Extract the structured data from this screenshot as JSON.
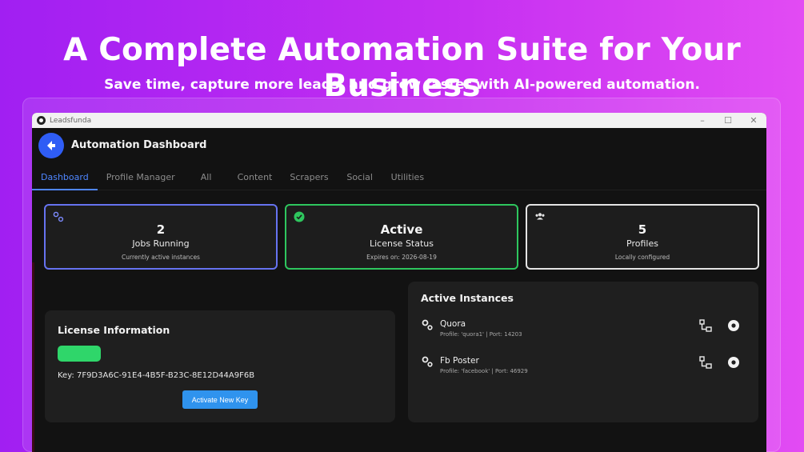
{
  "hero": {
    "title": "A Complete Automation Suite for Your Business",
    "subtitle": "Save time, capture more leads, and grow faster with AI-powered automation."
  },
  "window": {
    "app_name": "Leadsfunda",
    "controls": {
      "minimize": "–",
      "maximize": "☐",
      "close": "✕"
    }
  },
  "header": {
    "title": "Automation Dashboard"
  },
  "tabs": [
    {
      "label": "Dashboard",
      "active": true
    },
    {
      "label": "Profile Manager"
    },
    {
      "label": "All"
    },
    {
      "label": "Content"
    },
    {
      "label": "Scrapers"
    },
    {
      "label": "Social"
    },
    {
      "label": "Utilities"
    }
  ],
  "stats": [
    {
      "value": "2",
      "label": "Jobs Running",
      "sub": "Currently active instances",
      "icon": "gears-icon",
      "color": "#6673f0"
    },
    {
      "value": "Active",
      "label": "License Status",
      "sub": "Expires on: 2026-08-19",
      "icon": "verified-check-icon",
      "color": "#2ec65e"
    },
    {
      "value": "5",
      "label": "Profiles",
      "sub": "Locally configured",
      "icon": "users-icon",
      "color": "#e4e4e4"
    }
  ],
  "license": {
    "title": "License Information",
    "badge_color": "#2fd66a",
    "key_text": "Key: 7F9D3A6C-91E4-4B5F-B23C-8E12D44A9F6B",
    "activate_label": "Activate New Key"
  },
  "instances": {
    "title": "Active Instances",
    "items": [
      {
        "name": "Quora",
        "meta": "Profile: 'quora1' | Port: 14203"
      },
      {
        "name": "Fb Poster",
        "meta": "Profile: 'facebook' | Port: 46929"
      }
    ]
  },
  "colors": {
    "accent": "#4f86ff",
    "button": "#2f93ee",
    "background_gradient_start": "#a11ff2",
    "background_gradient_end": "#e24bf3"
  }
}
